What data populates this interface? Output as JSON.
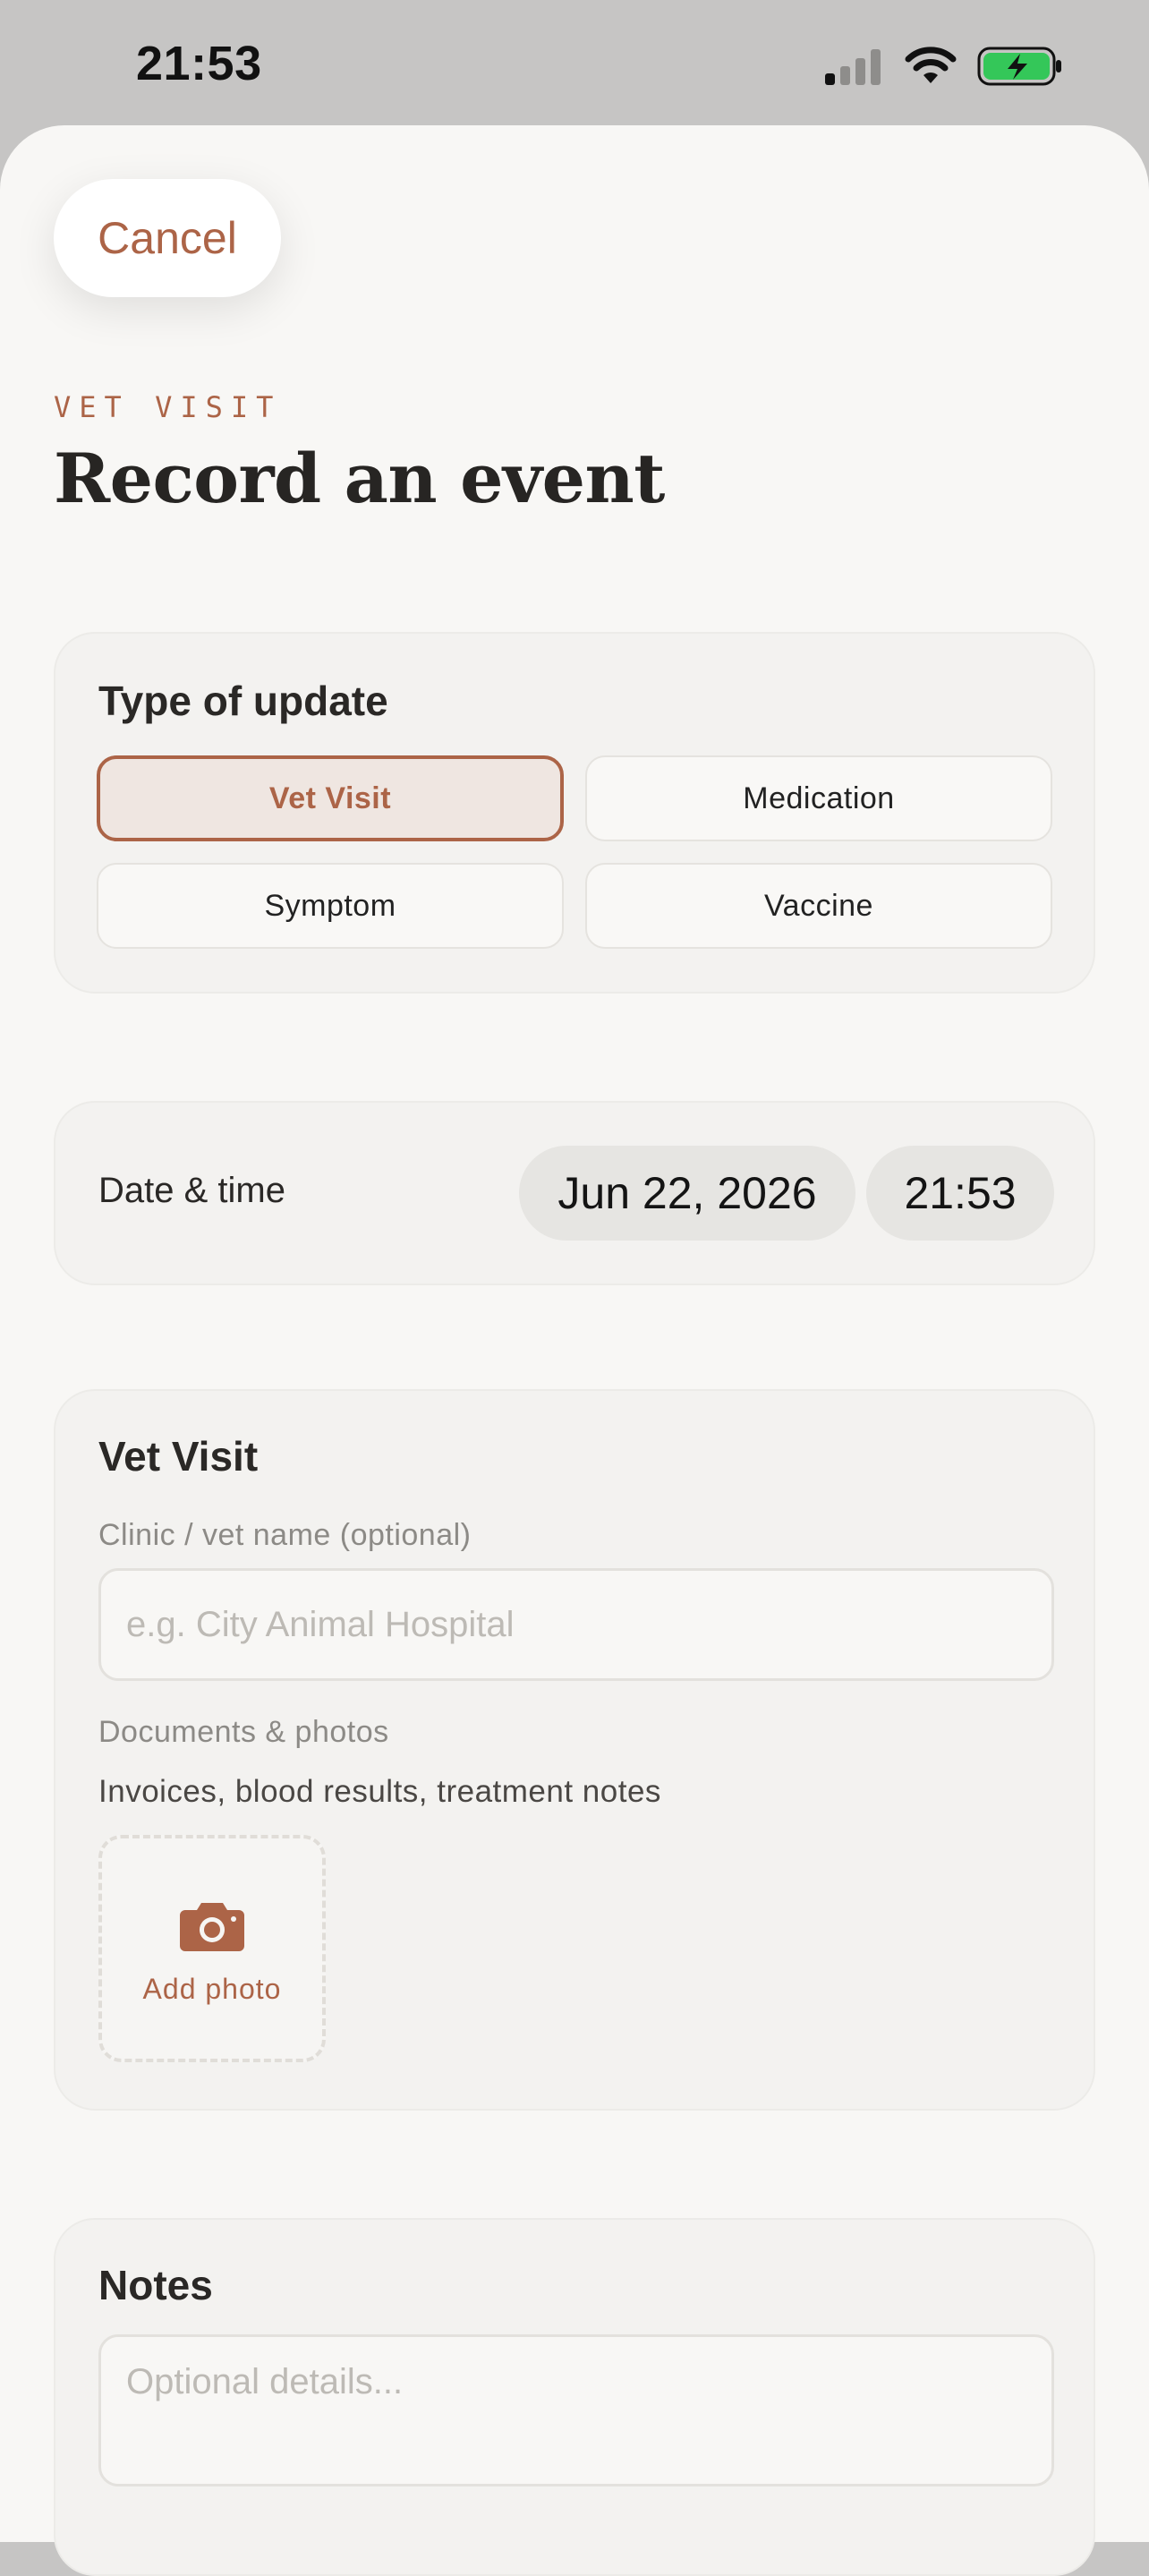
{
  "status_bar": {
    "time": "21:53",
    "icons": [
      "cellular-signal-icon",
      "wifi-icon",
      "battery-charging-icon"
    ],
    "battery_color": "#34c759"
  },
  "header": {
    "cancel_label": "Cancel",
    "eyebrow": "VET VISIT",
    "title": "Record an event"
  },
  "type_of_update": {
    "heading": "Type of update",
    "options": [
      "Vet Visit",
      "Medication",
      "Symptom",
      "Vaccine"
    ],
    "selected": "Vet Visit"
  },
  "date_time": {
    "label": "Date & time",
    "date": "Jun 22, 2026",
    "time": "21:53"
  },
  "vet_visit": {
    "heading": "Vet Visit",
    "clinic_label": "Clinic / vet name (optional)",
    "clinic_placeholder": "e.g. City Animal Hospital",
    "documents_label": "Documents & photos",
    "documents_help": "Invoices, blood results, treatment notes",
    "add_photo_label": "Add photo"
  },
  "notes": {
    "heading": "Notes",
    "placeholder": "Optional details..."
  },
  "colors": {
    "accent": "#ac6447",
    "background": "#f8f7f5",
    "card": "#f3f2f0"
  }
}
